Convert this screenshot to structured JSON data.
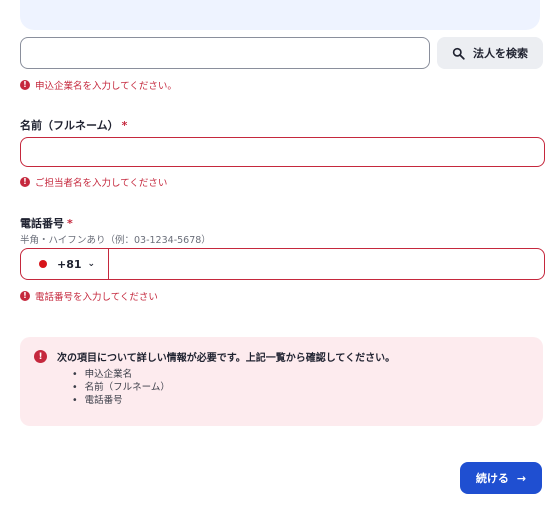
{
  "company": {
    "input_value": "",
    "search_button_label": "法人を検索",
    "error": "申込企業名を入力してください。"
  },
  "name": {
    "label": "名前（フルネーム）",
    "required_mark": "*",
    "input_value": "",
    "error": "ご担当者名を入力してください"
  },
  "phone": {
    "label": "電話番号",
    "required_mark": "*",
    "hint": "半角・ハイフンあり（例：03-1234-5678）",
    "country_code": "+81",
    "chevron": "⌄",
    "input_value": "",
    "error": "電話番号を入力してください"
  },
  "alert": {
    "icon": "!",
    "message": "次の項目について詳しい情報が必要です。上記一覧から確認してください。",
    "items": [
      "申込企業名",
      "名前（フルネーム）",
      "電話番号"
    ]
  },
  "footer": {
    "continue_label": "続ける",
    "continue_arrow": "→"
  },
  "colors": {
    "error": "#c5283d",
    "primary": "#1f4fd1",
    "alert_bg": "#fdebee"
  }
}
